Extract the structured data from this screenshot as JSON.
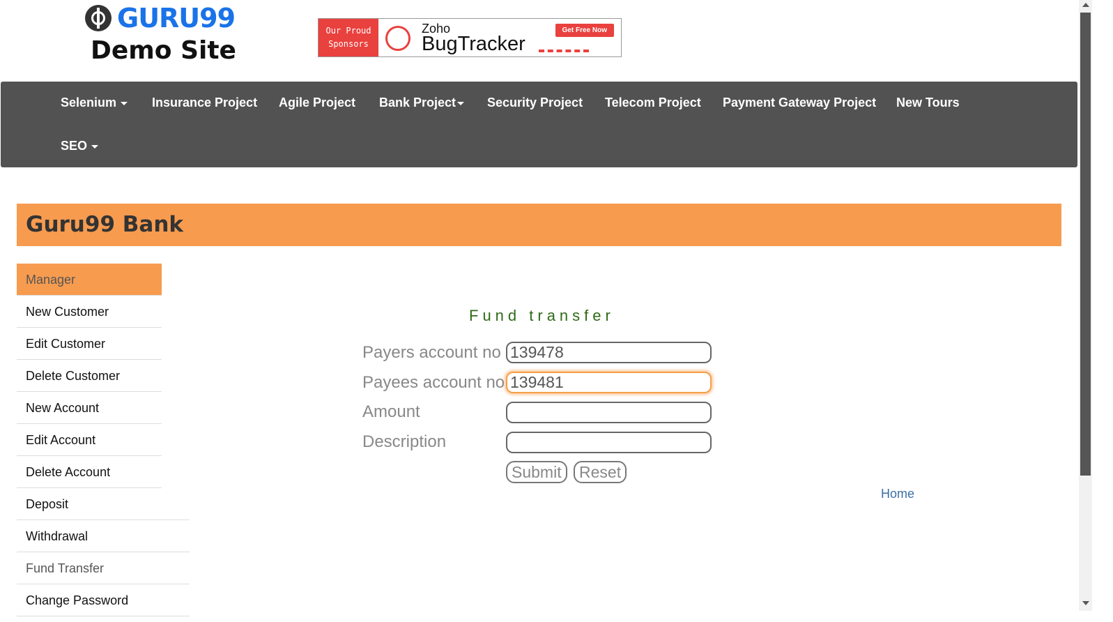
{
  "header": {
    "logo_text": "GURU99",
    "logo_subtitle": "Demo Site",
    "banner": {
      "left_line1": "Our Proud",
      "left_line2": "Sponsors",
      "brand_top": "Zoho",
      "brand_main": "BugTracker",
      "cta": "Get Free Now"
    }
  },
  "nav": {
    "items": [
      {
        "label": "Selenium",
        "has_dropdown": true
      },
      {
        "label": "Insurance Project",
        "has_dropdown": false
      },
      {
        "label": "Agile Project",
        "has_dropdown": false
      },
      {
        "label": "Bank Project",
        "has_dropdown": true
      },
      {
        "label": "Security Project",
        "has_dropdown": false
      },
      {
        "label": "Telecom Project",
        "has_dropdown": false
      },
      {
        "label": "Payment Gateway Project",
        "has_dropdown": false
      },
      {
        "label": "New Tours",
        "has_dropdown": false
      },
      {
        "label": "SEO",
        "has_dropdown": true
      }
    ]
  },
  "bank": {
    "title": "Guru99 Bank"
  },
  "sidebar": {
    "items": [
      {
        "label": "Manager"
      },
      {
        "label": "New Customer"
      },
      {
        "label": "Edit Customer"
      },
      {
        "label": "Delete Customer"
      },
      {
        "label": "New Account"
      },
      {
        "label": "Edit Account"
      },
      {
        "label": "Delete Account"
      },
      {
        "label": "Deposit"
      },
      {
        "label": "Withdrawal"
      },
      {
        "label": "Fund Transfer"
      },
      {
        "label": "Change Password"
      }
    ]
  },
  "form": {
    "title": "Fund transfer",
    "payers_label": "Payers account no",
    "payers_value": "139478",
    "payees_label": "Payees account no",
    "payees_value": "139481",
    "amount_label": "Amount",
    "amount_value": "",
    "description_label": "Description",
    "description_value": "",
    "submit_label": "Submit",
    "reset_label": "Reset"
  },
  "footer": {
    "home_label": "Home"
  },
  "colors": {
    "accent_orange": "#f79b4f",
    "nav_bg": "#525252",
    "form_title_green": "#2e6b17",
    "link_blue": "#3a6fa6",
    "sponsor_red": "#e9413e"
  }
}
